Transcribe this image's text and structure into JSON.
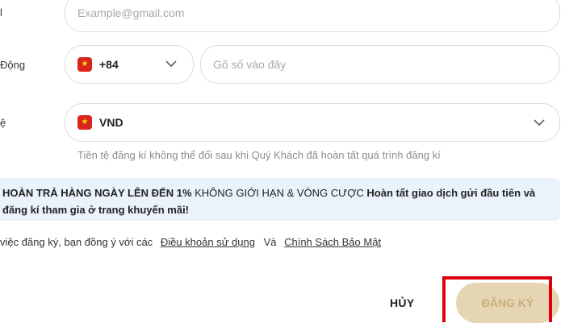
{
  "form": {
    "email": {
      "label": "l",
      "placeholder": "Example@gmail.com"
    },
    "phone": {
      "label": "Động",
      "country_code": "+84",
      "flag_icon": "vietnam-flag-icon",
      "placeholder": "Gõ số vào đây"
    },
    "currency": {
      "label": "ệ",
      "value": "VND",
      "flag_icon": "vietnam-flag-icon",
      "hint": "Tiền tệ đăng kí không thể đổi sau khi Quý Khách đã hoàn tất quá trình đăng kí"
    }
  },
  "promo": {
    "part1": "HOÀN TRẢ HÀNG NGÀY LÊN ĐẾN 1%",
    "part2": " KHÔNG GIỚI HẠN & VÒNG CƯỢC ",
    "part3": "Hoàn tất giao dịch gửi đầu tiên và",
    "part4": "đăng kí tham gia ở trang khuyến mãi!"
  },
  "terms": {
    "prefix": "việc đăng ký, bạn đồng ý với các",
    "terms_link": "Điều khoản sử dụng",
    "and": "Và",
    "privacy_link": "Chính Sách Bảo Mật"
  },
  "actions": {
    "cancel_label": "HỦY",
    "register_label": "ĐĂNG KÝ"
  },
  "colors": {
    "register_bg": "#e6d5b3",
    "register_text": "#c9ae7c",
    "banner_bg": "#eaf2fb",
    "highlight": "#e0000b"
  }
}
